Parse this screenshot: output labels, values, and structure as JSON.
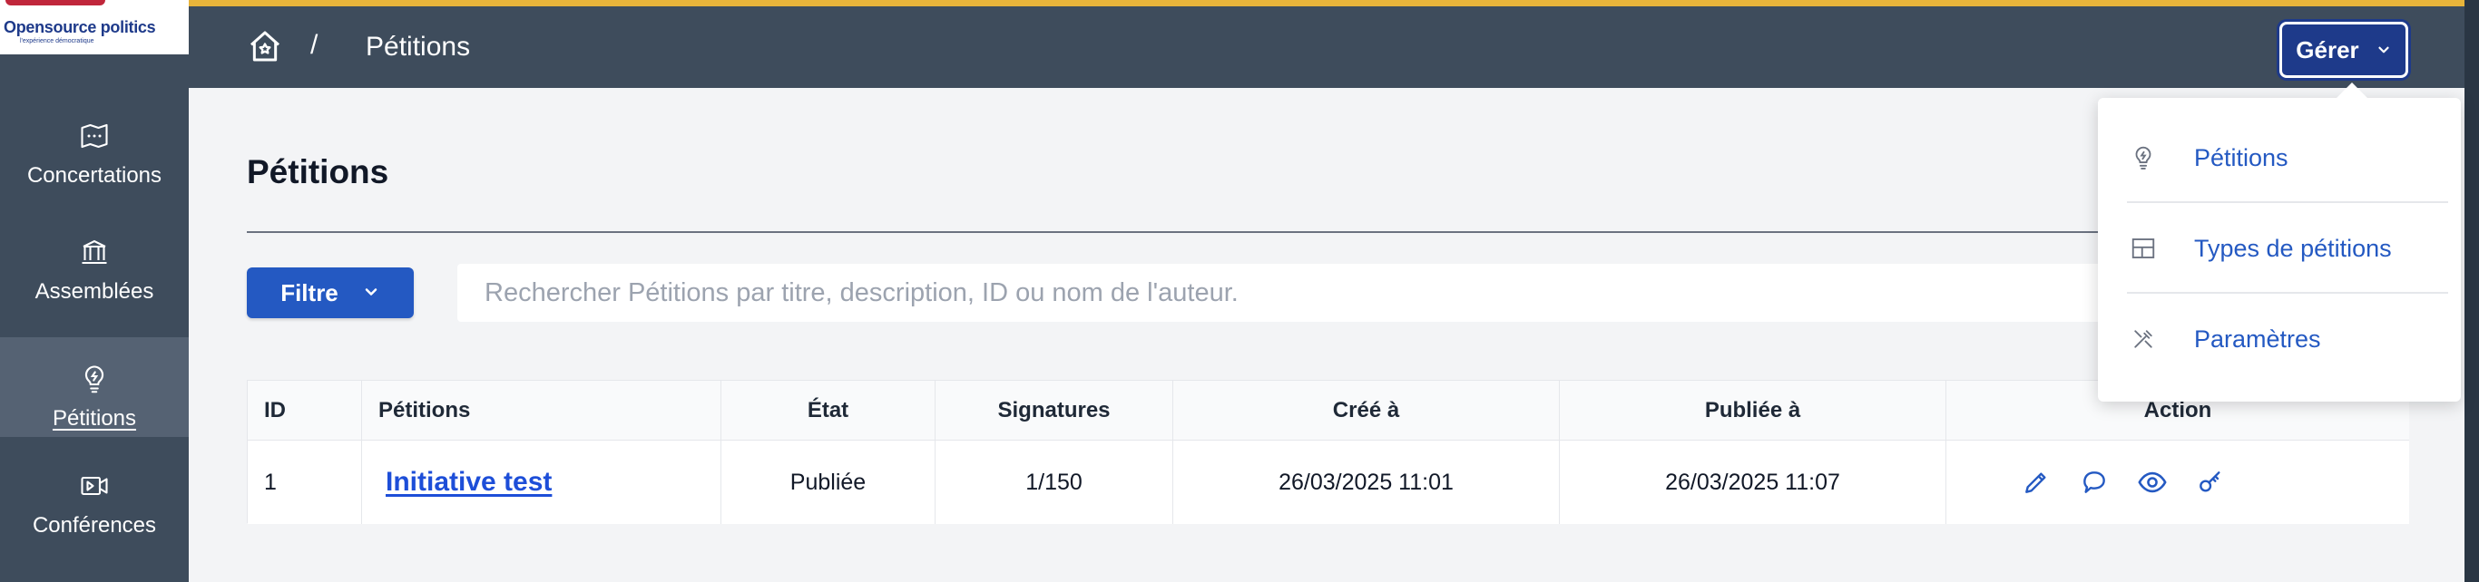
{
  "brand": {
    "logo_text": "Opensource politics",
    "logo_tagline": "l'expérience démocratique"
  },
  "sidebar": {
    "items": [
      {
        "label": "Concertations",
        "icon": "map-icon",
        "active": false
      },
      {
        "label": "Assemblées",
        "icon": "institution-icon",
        "active": false
      },
      {
        "label": "Pétitions",
        "icon": "lightbulb-icon",
        "active": true
      },
      {
        "label": "Conférences",
        "icon": "video-icon",
        "active": false
      }
    ]
  },
  "header": {
    "breadcrumb_separator": "/",
    "breadcrumb_current": "Pétitions",
    "manage_label": "Gérer"
  },
  "manage_menu": {
    "items": [
      {
        "label": "Pétitions",
        "icon": "lightbulb-icon"
      },
      {
        "label": "Types de pétitions",
        "icon": "layout-icon"
      },
      {
        "label": "Paramètres",
        "icon": "tools-icon"
      }
    ]
  },
  "main": {
    "title": "Pétitions",
    "filter_label": "Filtre",
    "search_placeholder": "Rechercher Pétitions par titre, description, ID ou nom de l'auteur."
  },
  "table": {
    "columns": [
      "ID",
      "Pétitions",
      "État",
      "Signatures",
      "Créé à",
      "Publiée à",
      "Action"
    ],
    "rows": [
      {
        "id": "1",
        "title": "Initiative test",
        "state": "Publiée",
        "signatures": "1/150",
        "created_at": "26/03/2025 11:01",
        "published_at": "26/03/2025 11:07",
        "actions": [
          "pencil-icon",
          "comment-icon",
          "eye-icon",
          "key-icon"
        ]
      }
    ]
  },
  "colors": {
    "sidebar_bg": "#3e4c5c",
    "top_accent": "#e8b43a",
    "primary": "#2459c2",
    "manage_button": "#1e3a8a"
  }
}
